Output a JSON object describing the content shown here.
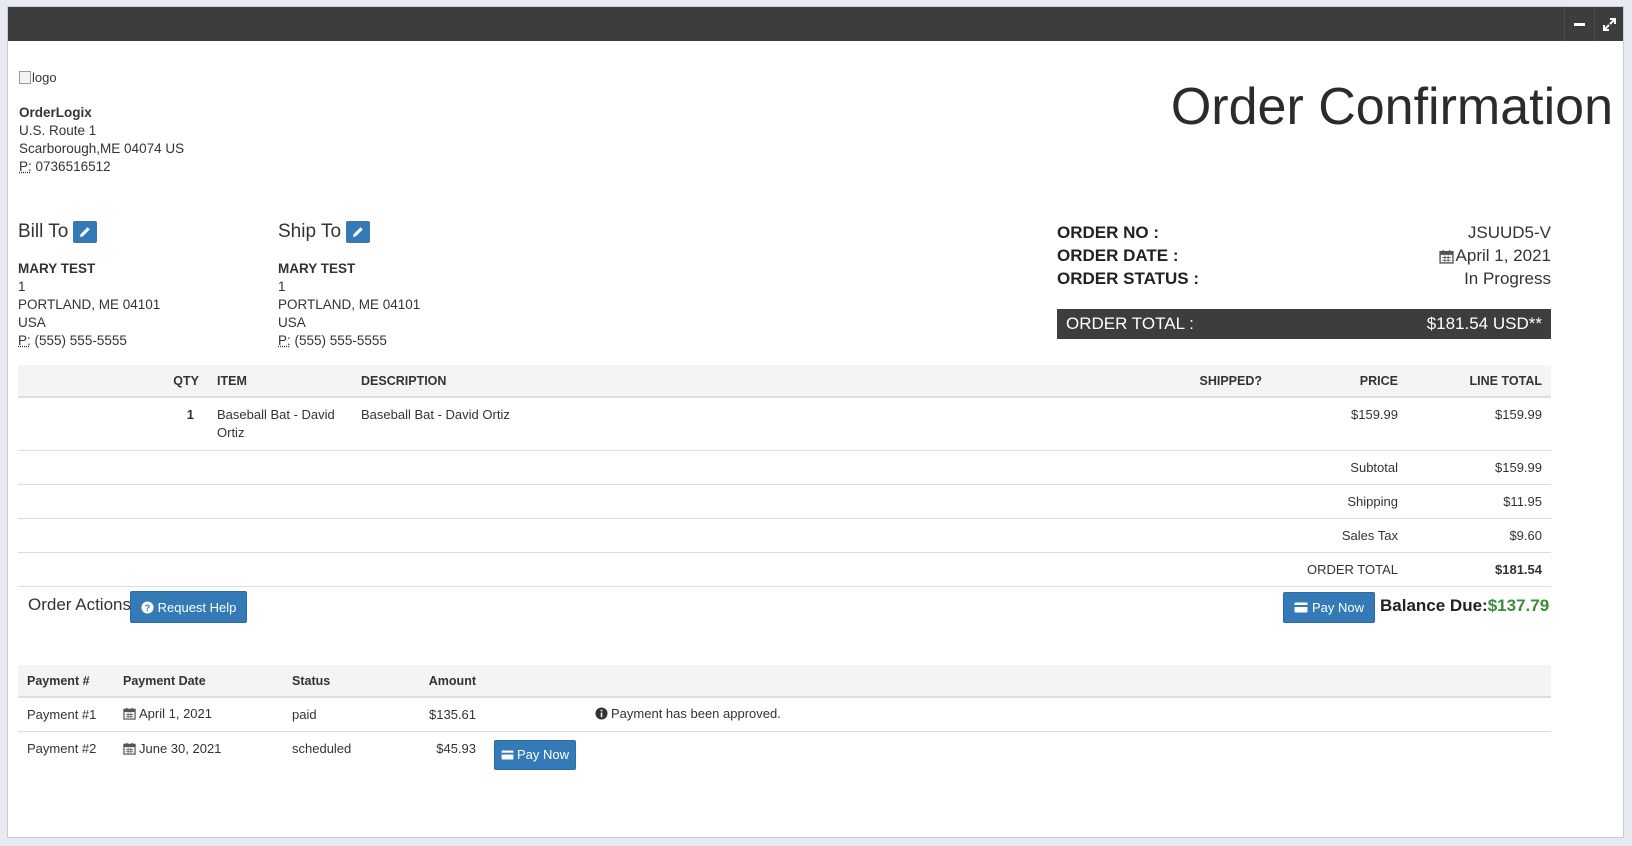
{
  "company": {
    "logo_alt": "logo",
    "name": "OrderLogix",
    "address1": "U.S. Route 1",
    "address2": "Scarborough,ME 04074 US",
    "phone_label": "P:",
    "phone": "0736516512"
  },
  "page_title": "Order Confirmation",
  "bill_to": {
    "heading": "Bill To",
    "name": "MARY TEST",
    "line1": "1",
    "line2": "PORTLAND, ME 04101",
    "country": "USA",
    "phone_label": "P:",
    "phone": "(555) 555-5555"
  },
  "ship_to": {
    "heading": "Ship To",
    "name": "MARY TEST",
    "line1": "1",
    "line2": "PORTLAND, ME 04101",
    "country": "USA",
    "phone_label": "P:",
    "phone": "(555) 555-5555"
  },
  "order_meta": {
    "no_label": "ORDER NO :",
    "no_value": "JSUUD5-V",
    "date_label": "ORDER DATE :",
    "date_value": "April 1, 2021",
    "status_label": "ORDER STATUS :",
    "status_value": "In Progress",
    "total_label": "ORDER TOTAL :",
    "total_value": "$181.54 USD**"
  },
  "items_table": {
    "headers": [
      "QTY",
      "ITEM",
      "DESCRIPTION",
      "SHIPPED?",
      "PRICE",
      "LINE TOTAL"
    ],
    "rows": [
      {
        "qty": "1",
        "item": "Baseball Bat - David Ortiz",
        "description": "Baseball Bat - David Ortiz",
        "shipped": "",
        "price": "$159.99",
        "line_total": "$159.99"
      }
    ],
    "summary": [
      {
        "label": "Subtotal",
        "value": "$159.99"
      },
      {
        "label": "Shipping",
        "value": "$11.95"
      },
      {
        "label": "Sales Tax",
        "value": "$9.60"
      },
      {
        "label": "ORDER TOTAL",
        "value": "$181.54"
      }
    ]
  },
  "actions": {
    "title": "Order Actions",
    "request_help": "Request Help",
    "pay_now": "Pay Now",
    "balance_label": "Balance Due:",
    "balance_value": "$137.79"
  },
  "payments": {
    "headers": [
      "Payment #",
      "Payment Date",
      "Status",
      "Amount"
    ],
    "rows": [
      {
        "number": "Payment #1",
        "date": "April 1, 2021",
        "status": "paid",
        "amount": "$135.61",
        "note": "Payment has been approved."
      },
      {
        "number": "Payment #2",
        "date": "June 30, 2021",
        "status": "scheduled",
        "amount": "$45.93",
        "pay_label": "Pay Now"
      }
    ]
  },
  "colors": {
    "primary": "#337ab7",
    "dark_bar": "#3d3d3d",
    "balance_green": "#3c8c3c"
  },
  "icons": [
    "minimize-icon",
    "expand-icon",
    "pencil-icon",
    "calendar-icon",
    "question-circle-icon",
    "credit-card-icon",
    "info-circle-icon"
  ]
}
